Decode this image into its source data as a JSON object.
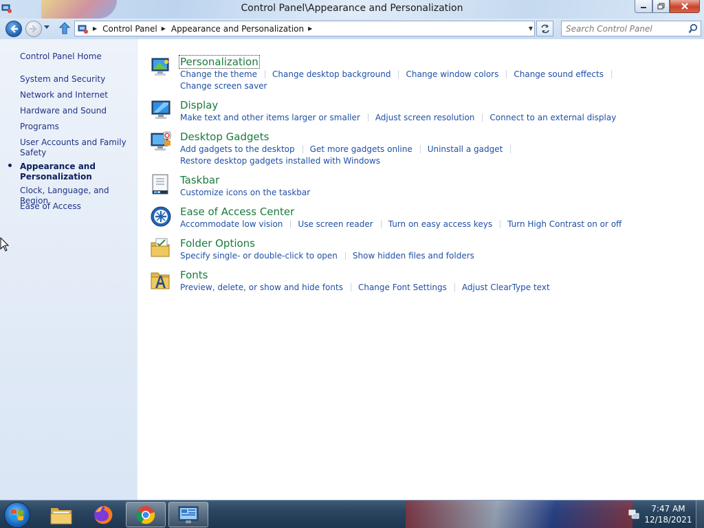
{
  "window": {
    "title": "Control Panel\\Appearance and Personalization"
  },
  "nav": {
    "breadcrumbs": [
      "Control Panel",
      "Appearance and Personalization"
    ],
    "search_placeholder": "Search Control Panel"
  },
  "sidebar": {
    "home": "Control Panel Home",
    "items": [
      {
        "label": "System and Security"
      },
      {
        "label": "Network and Internet"
      },
      {
        "label": "Hardware and Sound"
      },
      {
        "label": "Programs"
      },
      {
        "label": "User Accounts and Family Safety"
      },
      {
        "label": "Appearance and Personalization",
        "current": true
      },
      {
        "label": "Clock, Language, and Region"
      },
      {
        "label": "Ease of Access"
      }
    ]
  },
  "categories": [
    {
      "title": "Personalization",
      "icon": "personalization-icon",
      "tasks": [
        [
          "Change the theme",
          "Change desktop background",
          "Change window colors",
          "Change sound effects"
        ],
        [
          "Change screen saver"
        ]
      ]
    },
    {
      "title": "Display",
      "icon": "display-icon",
      "tasks": [
        [
          "Make text and other items larger or smaller",
          "Adjust screen resolution",
          "Connect to an external display"
        ]
      ]
    },
    {
      "title": "Desktop Gadgets",
      "icon": "desktop-gadgets-icon",
      "tasks": [
        [
          "Add gadgets to the desktop",
          "Get more gadgets online",
          "Uninstall a gadget"
        ],
        [
          "Restore desktop gadgets installed with Windows"
        ]
      ]
    },
    {
      "title": "Taskbar",
      "icon": "taskbar-icon",
      "tasks": [
        [
          "Customize icons on the taskbar"
        ]
      ]
    },
    {
      "title": "Ease of Access Center",
      "icon": "ease-of-access-icon",
      "tasks": [
        [
          "Accommodate low vision",
          "Use screen reader",
          "Turn on easy access keys",
          "Turn High Contrast on or off"
        ]
      ]
    },
    {
      "title": "Folder Options",
      "icon": "folder-options-icon",
      "tasks": [
        [
          "Specify single- or double-click to open",
          "Show hidden files and folders"
        ]
      ]
    },
    {
      "title": "Fonts",
      "icon": "fonts-icon",
      "tasks": [
        [
          "Preview, delete, or show and hide fonts",
          "Change Font Settings",
          "Adjust ClearType text"
        ]
      ]
    }
  ],
  "taskbar": {
    "buttons": [
      {
        "name": "windows-explorer",
        "icon": "folder-icon"
      },
      {
        "name": "firefox",
        "icon": "firefox-icon"
      },
      {
        "name": "chrome",
        "icon": "chrome-icon"
      },
      {
        "name": "control-panel",
        "icon": "control-panel-icon",
        "active": true
      }
    ],
    "time": "7:47 AM",
    "date": "12/18/2021"
  },
  "colors": {
    "link": "#1f4fa5",
    "category_title": "#1b7a3c",
    "sidebar_link": "#1e3287"
  }
}
